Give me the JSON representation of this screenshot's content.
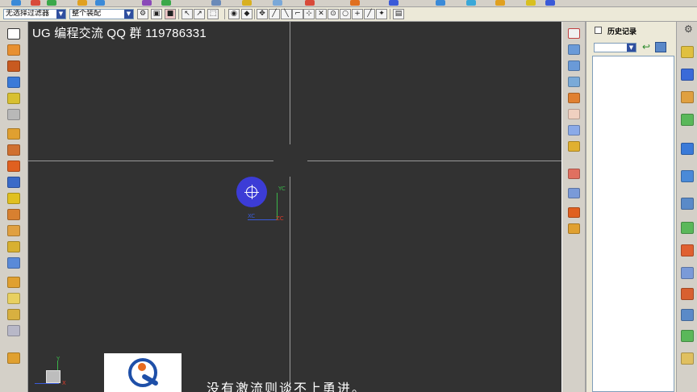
{
  "toolbar": {
    "selection_filter": "无选择过滤器",
    "assembly_scope": "整个装配"
  },
  "viewport": {
    "overlay_title": "UG 编程交流 QQ 群 119786331",
    "subtitle": "没有激流则谈不上勇进。",
    "axis_labels": {
      "yc": "YC",
      "xc": "XC",
      "zc": "ZC"
    },
    "triad_labels": {
      "y": "Y",
      "x": "X"
    },
    "background_color": "#323232"
  },
  "history_panel": {
    "title": "历史记录",
    "back_icon": "undo-arrow-icon",
    "view_icon": "view-mode-icon"
  },
  "icons": {
    "settings": "gear-icon",
    "cursor": "select-cursor-icon"
  },
  "colors": {
    "cursor_blue": "#3c3cd6",
    "axis_green": "#3bb54a",
    "axis_blue": "#3a5bd9",
    "axis_red": "#d83a2a"
  }
}
